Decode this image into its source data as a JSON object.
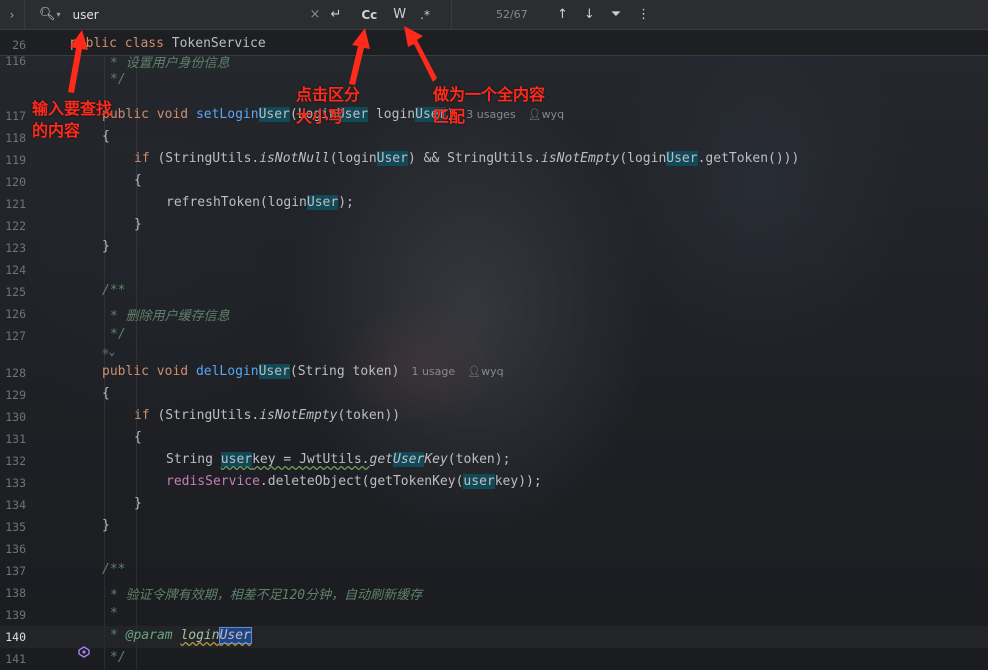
{
  "findbar": {
    "expand_glyph": "›",
    "search_icon_glyph": "🔍︎",
    "search_value": "user",
    "clear_glyph": "×",
    "newline_glyph": "↵",
    "case_label": "Cc",
    "word_label": "W",
    "regex_label": ".*",
    "match_count": "52/67",
    "up_glyph": "↑",
    "down_glyph": "↓",
    "filter_glyph": "⏷",
    "more_glyph": "⋮"
  },
  "editor": {
    "sticky_line_number": "26",
    "lines": {
      "l116": "116",
      "l117": "117",
      "l118": "118",
      "l119": "119",
      "l120": "120",
      "l121": "121",
      "l122": "122",
      "l123": "123",
      "l124": "124",
      "l125": "125",
      "l126": "126",
      "l127": "127",
      "l128": "128",
      "l129": "129",
      "l130": "130",
      "l131": "131",
      "l132": "132",
      "l133": "133",
      "l134": "134",
      "l135": "135",
      "l136": "136",
      "l137": "137",
      "l138": "138",
      "l139": "139",
      "l140": "140",
      "l141": "141"
    },
    "code": {
      "sticky_kw1": "public",
      "sticky_kw2": "class",
      "sticky_name": "TokenService",
      "c116": "* 设置用户身份信息",
      "c116b": "*/",
      "set_kw1": "public",
      "set_kw2": "void",
      "set_fn1": "setLogin",
      "set_fn2": "User",
      "set_param_type1": "Login",
      "set_param_type2": "User",
      "set_param_name1": "login",
      "set_param_name2": "User",
      "set_close": ")",
      "set_usages": "3 usages",
      "set_author": "wyq",
      "brace_open": "{",
      "brace_close": "}",
      "if_kw": "if",
      "l119_a": "(StringUtils.",
      "l119_fn1": "isNotNull",
      "l119_b": "(login",
      "l119_hl1": "User",
      "l119_c": ") && StringUtils.",
      "l119_fn2": "isNotEmpty",
      "l119_d": "(login",
      "l119_hl2": "User",
      "l119_e": ".getToken()))",
      "l121_a": "refreshToken(login",
      "l121_hl": "User",
      "l121_b": ");",
      "c125": "/**",
      "c126": "* 删除用户缓存信息",
      "c127": "*/",
      "del_kw1": "public",
      "del_kw2": "void",
      "del_fn1": "delLogin",
      "del_fn2": "User",
      "del_params": "(String token)",
      "del_usages": "1 usage",
      "del_author": "wyq",
      "l130_a": "(StringUtils.",
      "l130_fn": "isNotEmpty",
      "l130_b": "(token))",
      "l132_a": "String ",
      "l132_hl": "user",
      "l132_b": "key = JwtUtils.",
      "l132_fn1": "get",
      "l132_hl2": "User",
      "l132_fn2": "Key",
      "l132_c": "(token);",
      "l133_mem": "redisService",
      "l133_a": ".deleteObject(getTokenKey(",
      "l133_hl": "user",
      "l133_b": "key));",
      "c137": "/**",
      "c138": "* 验证令牌有效期，相差不足120分钟，自动刷新缓存",
      "c139": "*",
      "c140_star": "* ",
      "c140_tag": "@param",
      "c140_name": "login",
      "c140_hl": "User",
      "c141": "*/"
    }
  },
  "annotations": {
    "search_hint_line1": "输入要查找",
    "search_hint_line2": "的内容",
    "case_hint_line1": "点击区分",
    "case_hint_line2": "大小写",
    "word_hint_line1": "做为一个全内容",
    "word_hint_line2": "匹配"
  },
  "colors": {
    "annotation_red": "#ff2a1a",
    "match_highlight": "#114957",
    "current_match": "#214283"
  }
}
